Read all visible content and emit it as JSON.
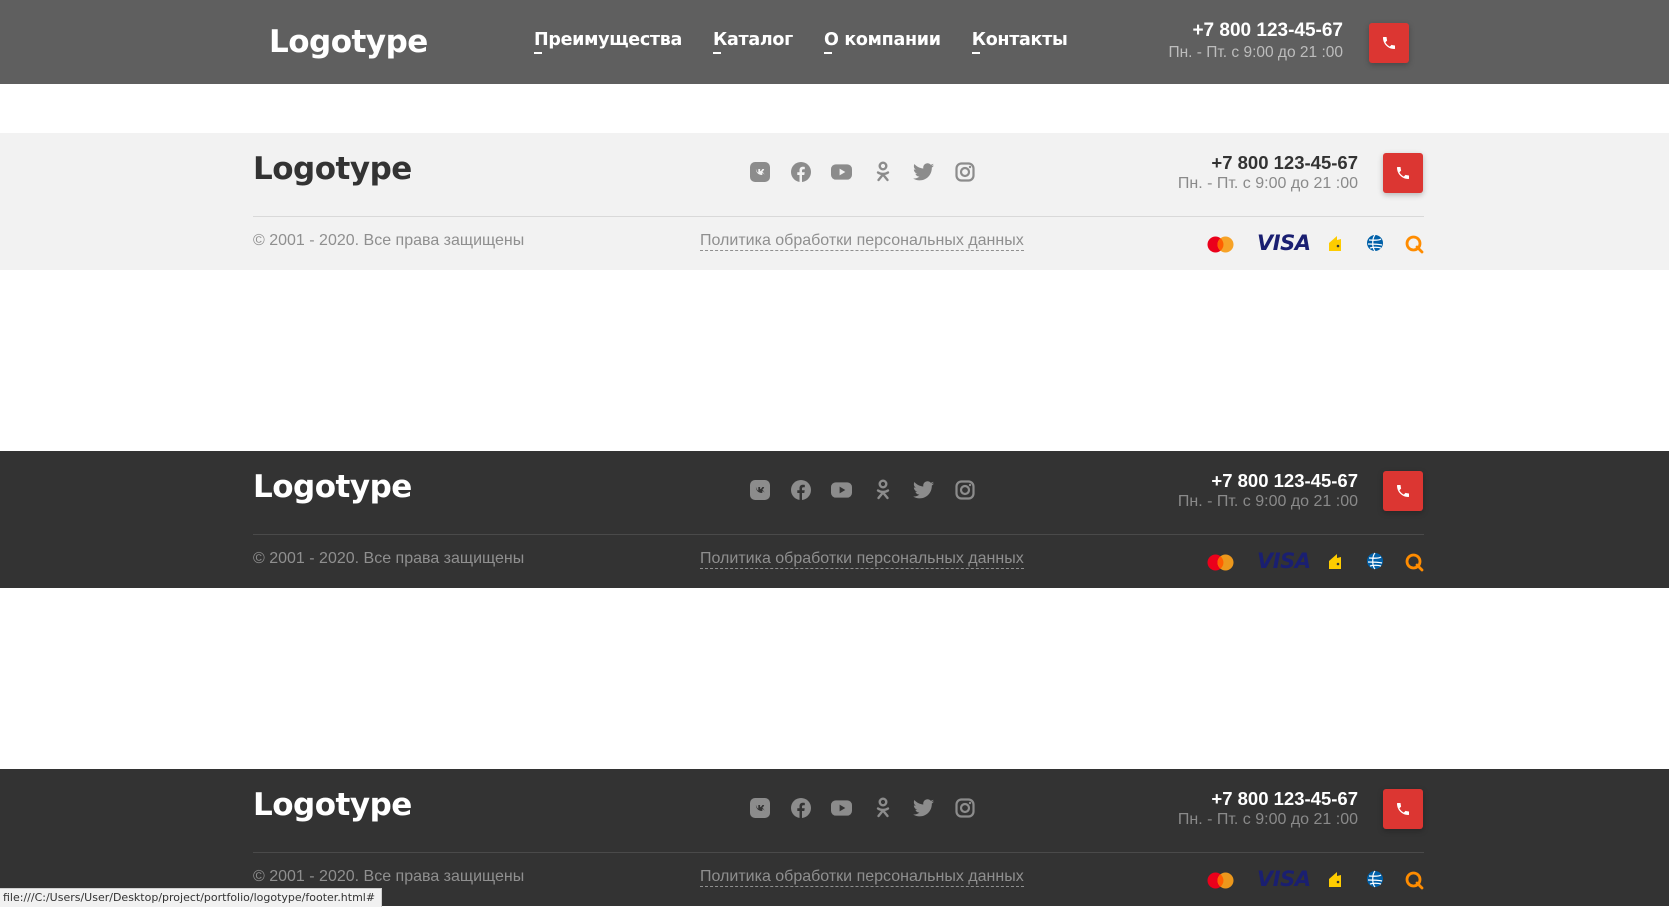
{
  "header": {
    "logo": "Logotype",
    "nav": [
      "Преимущества",
      "Каталог",
      "О компании",
      "Контакты"
    ],
    "phone": "+7 800 123-45-67",
    "hours": "Пн. - Пт. с 9:00 до 21 :00"
  },
  "footer": {
    "logo": "Logotype",
    "phone": "+7 800 123-45-67",
    "hours": "Пн. - Пт. с 9:00 до 21 :00",
    "copyright": "© 2001 - 2020. Все права защищены",
    "policy": "Политика обработки персональных данных",
    "social_icons": [
      "vk-icon",
      "facebook-icon",
      "youtube-icon",
      "odnoklassniki-icon",
      "twitter-icon",
      "instagram-icon"
    ],
    "payment_icons": [
      "mastercard-icon",
      "visa-icon",
      "yandex-money-icon",
      "webmoney-icon",
      "qiwi-icon"
    ],
    "visa_text": "VISA"
  },
  "status_url": "file:///C:/Users/User/Desktop/project/portfolio/logotype/footer.html#",
  "colors": {
    "header_bg": "#5f5f5f",
    "footer_light_bg": "#f2f2f2",
    "footer_dark_bg": "#333333",
    "accent_red": "#dc3632",
    "icon_grey": "#8f8f8f"
  }
}
